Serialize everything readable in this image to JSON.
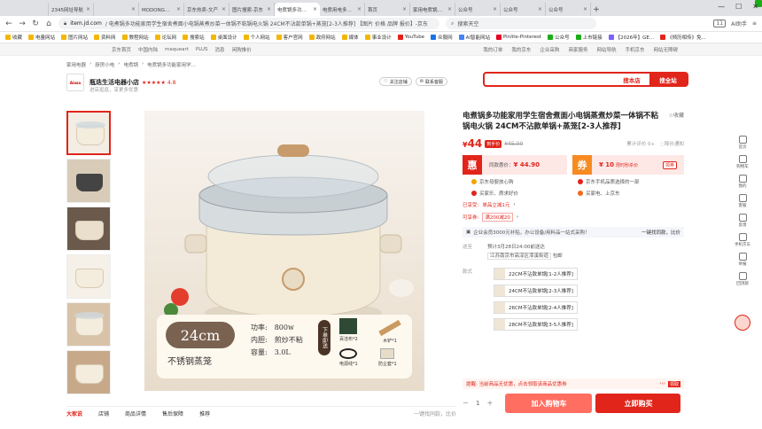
{
  "browser": {
    "tabs": [
      {
        "title": "2345网址导航",
        "color": "#2d6fd8"
      },
      {
        "title": "",
        "color": "#4c8cf5"
      },
      {
        "title": "MODONG多功能",
        "color": "#222"
      },
      {
        "title": "京东热卖-文产",
        "color": "#e1251b"
      },
      {
        "title": "图片搜索-京东",
        "color": "#e1251b"
      },
      {
        "title": "电煮锅多功能家",
        "color": "#e1251b",
        "active": true
      },
      {
        "title": "电煮用电多功能",
        "color": "#e1251b"
      },
      {
        "title": "首页",
        "color": "#f0a030"
      },
      {
        "title": "家用电煮锅大全",
        "color": "#f0a030"
      },
      {
        "title": "公众号",
        "color": "#1aad19"
      },
      {
        "title": "公众号",
        "color": "#1aad19"
      },
      {
        "title": "公众号",
        "color": "#1aad19"
      }
    ],
    "url_host": "item.jd.com",
    "url_rest": "/ 电煮锅多功能家用学生宿舍煮面小电锅蒸煮炒菜一体锅不粘锅电火锅 24CM不沾款单锅+蒸笼[2-3人推荐] 【图片 价格 品牌 报价】-京东",
    "search_placeholder": "搜索天空",
    "ai_label": "AI助手",
    "win_count": "11",
    "bookmarks": [
      "收藏",
      "电量网站",
      "图片网站",
      "资料网",
      "教程网站",
      "论坛网",
      "搜索站",
      "桌面设计",
      "个人网站",
      "客户官网",
      "政府网站",
      "媒体",
      "事业设计",
      "YouTube",
      "众服网",
      "AI智能网站",
      "Pinlite-Pinterest",
      "公众号",
      "上市链接",
      "【2026年】GE...",
      "《倾历相传》免..."
    ]
  },
  "jdtop": {
    "left": [
      "京东首页",
      "中国内陆",
      "maqueart",
      "PLUS",
      "消息",
      "闲购推价"
    ],
    "right": [
      "我的订单",
      "我的京东",
      "企业采购",
      "商家服务",
      "网站导航",
      "手机京东",
      "网站无障碍"
    ]
  },
  "breadcrumb": [
    "家用电器",
    "厨房小电",
    "电煮锅",
    "电煮锅多功能家用学..."
  ],
  "shop": {
    "logo": "Aiasa",
    "name": "瓶迭生活电器小店",
    "stars": "★★★★★",
    "score": "4.8",
    "subtitle": "进店逛逛，享更多优惠",
    "follow": "关注店铺",
    "service": "联系客服"
  },
  "search": {
    "btn_shop": "搜本店",
    "btn_all": "搜全站"
  },
  "image": {
    "size": "24cm",
    "material": "不锈钢蒸笼",
    "specs": [
      [
        "功率:",
        "800w"
      ],
      [
        "内胆:",
        "煎炒不粘"
      ],
      [
        "容量:",
        "3.0L"
      ]
    ],
    "bundle_tag": "下单即送",
    "accessories": [
      "百洁布*2",
      "木铲*1",
      "电源线*1",
      "防尘套*1"
    ]
  },
  "product": {
    "title": "电煮锅多功能家用学生宿舍煮面小电锅蒸煮炒菜一体锅不粘锅电火锅 24CM不沾款单锅+蒸笼[2-3人推荐]",
    "fav": "收藏",
    "price_symbol": "¥",
    "price": "44",
    "price_tag": "到手价",
    "old_price": "¥45.00",
    "reviews": "累计评价 0+",
    "report": "降价通知",
    "promo1_icon": "惠",
    "promo1_label": "同款惠价：",
    "promo1_price": "¥ 44.90",
    "promo2_icon": "券",
    "promo2_label": "¥ 10",
    "promo2_sub": "限时秒杀价",
    "promo2_get": "领券",
    "guarantees": [
      "京东母婴放心购",
      "京东手机品质选择的一部",
      "买家乐、质求好价",
      "买家电、上京东"
    ],
    "plus_label": "已享受:",
    "plus_value": "单品立减1元",
    "coupon_label": "可享券:",
    "coupon_value": "满200减20",
    "ad_text": "企业会员3000元补贴，办公设备/用料品一站式采购！",
    "ad_right": "一键找同款，比价",
    "delivery_label": "送至",
    "delivery_line1": "预计3月28日24:00前送达",
    "delivery_line2": "江苏南京市高淳区漆溪街道",
    "delivery_free": "包邮",
    "spec_label": "款式",
    "options": [
      "22CM不沾款单锅[1-2人推荐]",
      "24CM不沾款单锅[2-3人推荐]",
      "26CM不沾款单锅[2-4人推荐]",
      "28CM不沾款单锅[3-5人推荐]"
    ],
    "notice": "提醒: 当前商品无优惠，点击领取该商品优惠券",
    "notice_btn": "领取",
    "qty": "1",
    "add_cart": "加入购物车",
    "buy_now": "立即购买"
  },
  "bottom_tabs": [
    "大家说",
    "店铺",
    "商品详情",
    "售后保障",
    "推荐"
  ],
  "bottom_right": "一键找同款，比价",
  "sidebar": [
    "首页",
    "购物车",
    "我的",
    "客服",
    "反馈",
    "手机京东",
    "举报",
    "回顶部"
  ]
}
